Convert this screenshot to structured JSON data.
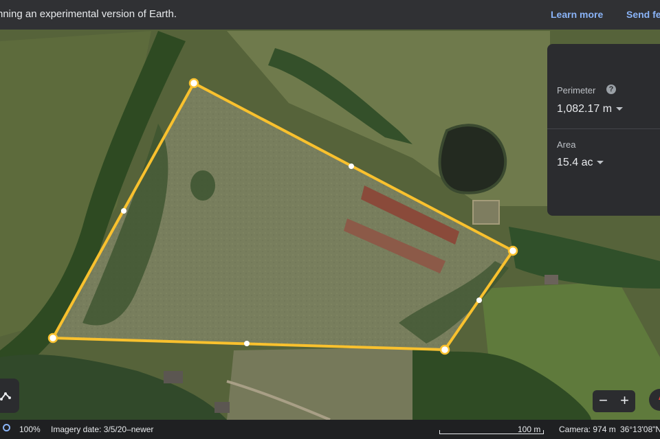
{
  "banner": {
    "message": "nning an experimental version of Earth.",
    "learn_more": "Learn more",
    "send_feedback": "Send fe"
  },
  "measure_panel": {
    "perimeter_label": "Perimeter",
    "perimeter_value": "1,082.17 m",
    "help_glyph": "?",
    "area_label": "Area",
    "area_value": "15.4 ac"
  },
  "zoom": {
    "minus": "−",
    "plus": "+"
  },
  "statusbar": {
    "zoom_percent": "100%",
    "imagery_date": "Imagery date: 3/5/20–newer",
    "scale": "100 m",
    "camera": "Camera: 974 m",
    "coords": "36°13'08\"N"
  },
  "colors": {
    "polygon_stroke": "#f9c12e",
    "link": "#8ab4f8",
    "panel_bg": "#2b2c2f",
    "banner_bg": "#303134"
  },
  "icons": [
    "help-icon",
    "globe-icon",
    "compass-icon",
    "path-tool-icon"
  ]
}
